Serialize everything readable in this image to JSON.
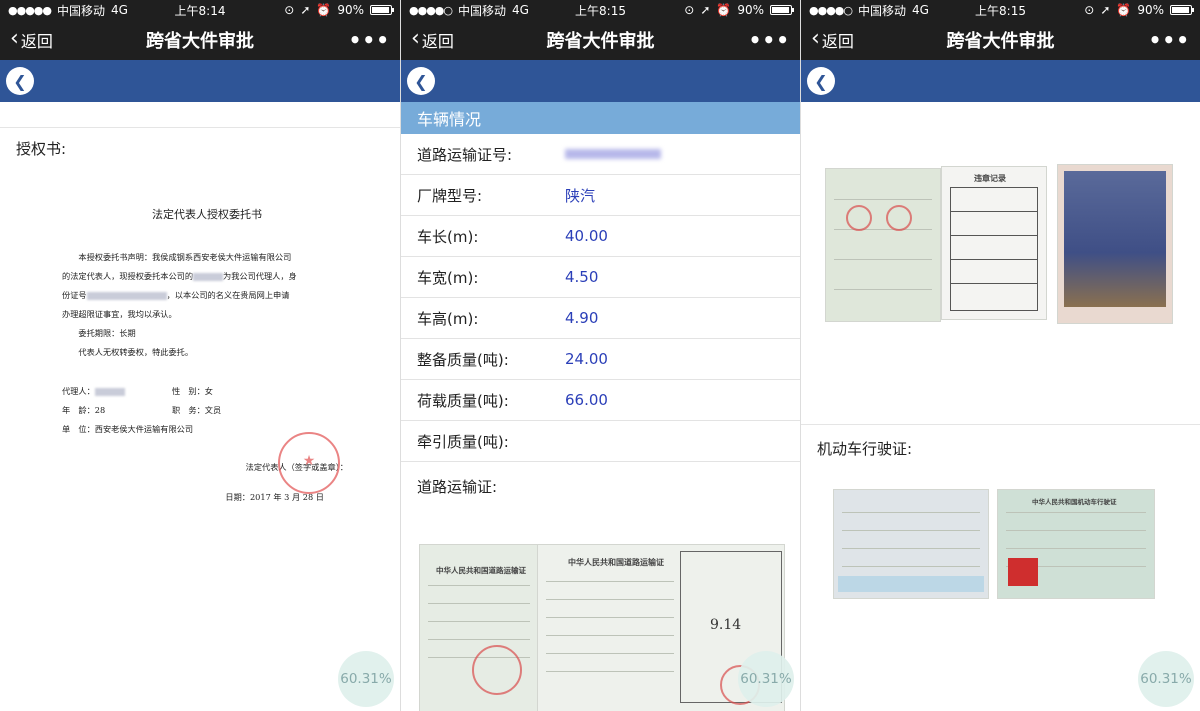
{
  "status": {
    "carrier": "中国移动",
    "network": "4G",
    "battery": "90%",
    "battery_level": 90,
    "times": [
      "上午8:14",
      "上午8:15",
      "上午8:15"
    ]
  },
  "nav": {
    "back_label": "返回",
    "title": "跨省大件审批",
    "more": "•••"
  },
  "badge": "60.31%",
  "screen1": {
    "label": "授权书:",
    "letter": {
      "title": "法定代表人授权委托书",
      "para1_a": "本授权委托书声明：我侯成钢系西安老侯大件运输有限公司",
      "para1_b": "的法定代表人，现授权委托本公司的",
      "para1_c": "为我公司代理人，身",
      "para1_d": "份证号",
      "para1_e": "，以本公司的名义在贵局网上申请",
      "para1_f": "办理超限证事宜，我均以承认。",
      "period": "委托期限：长期",
      "no_transfer": "代表人无权转委权，特此委托。",
      "agent": "代理人：",
      "gender": "性　别：女",
      "age": "年　龄：28",
      "position": "职　务：文员",
      "unit": "单　位：西安老侯大件运输有限公司",
      "signature": "法定代表人（签字或盖章）：",
      "date": "日期：2017 年 3 月 28 日"
    }
  },
  "screen2": {
    "section_title": "车辆情况",
    "rows": [
      {
        "k": "道路运输证号:",
        "v": ""
      },
      {
        "k": "厂牌型号:",
        "v": "陕汽"
      },
      {
        "k": "车长(m):",
        "v": "40.00"
      },
      {
        "k": "车宽(m):",
        "v": "4.50"
      },
      {
        "k": "车高(m):",
        "v": "4.90"
      },
      {
        "k": "整备质量(吨):",
        "v": "24.00"
      },
      {
        "k": "荷载质量(吨):",
        "v": "66.00"
      },
      {
        "k": "牵引质量(吨):",
        "v": ""
      }
    ],
    "cert_label": "道路运输证:",
    "cert_title": "中华人民共和国道路运输证",
    "cert_hand": "9.14"
  },
  "screen3": {
    "record_title": "违章记录",
    "license_label": "机动车行驶证:",
    "license_title": "中华人民共和国机动车行驶证"
  }
}
